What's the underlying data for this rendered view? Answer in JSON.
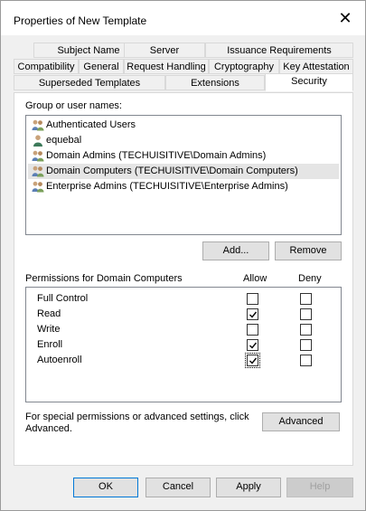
{
  "window": {
    "title": "Properties of New Template",
    "close_glyph": "✕"
  },
  "tabs": {
    "row1": [
      "Subject Name",
      "Server",
      "Issuance Requirements"
    ],
    "row2": [
      "Compatibility",
      "General",
      "Request Handling",
      "Cryptography",
      "Key Attestation"
    ],
    "row3": [
      "Superseded Templates",
      "Extensions",
      "Security"
    ],
    "active": "Security"
  },
  "security": {
    "group_label": "Group or user names:",
    "users": [
      {
        "name": "Authenticated Users",
        "icon": "group-icon",
        "selected": false
      },
      {
        "name": "equebal",
        "icon": "user-icon",
        "selected": false
      },
      {
        "name": "Domain Admins (TECHUISITIVE\\Domain Admins)",
        "icon": "group-icon",
        "selected": false
      },
      {
        "name": "Domain Computers (TECHUISITIVE\\Domain Computers)",
        "icon": "group-icon",
        "selected": true
      },
      {
        "name": "Enterprise Admins (TECHUISITIVE\\Enterprise Admins)",
        "icon": "group-icon",
        "selected": false
      }
    ],
    "add_label": "Add...",
    "remove_label": "Remove",
    "permissions_label": "Permissions for Domain Computers",
    "allow_header": "Allow",
    "deny_header": "Deny",
    "permissions": [
      {
        "name": "Full Control",
        "allow": false,
        "deny": false
      },
      {
        "name": "Read",
        "allow": true,
        "deny": false
      },
      {
        "name": "Write",
        "allow": false,
        "deny": false
      },
      {
        "name": "Enroll",
        "allow": true,
        "deny": false
      },
      {
        "name": "Autoenroll",
        "allow": true,
        "deny": false
      }
    ],
    "advanced_text": "For special permissions or advanced settings, click Advanced.",
    "advanced_label": "Advanced"
  },
  "footer": {
    "ok": "OK",
    "cancel": "Cancel",
    "apply": "Apply",
    "help": "Help"
  },
  "colors": {
    "selected_row": "#e5e5e5",
    "default_button_border": "#0078d7"
  }
}
